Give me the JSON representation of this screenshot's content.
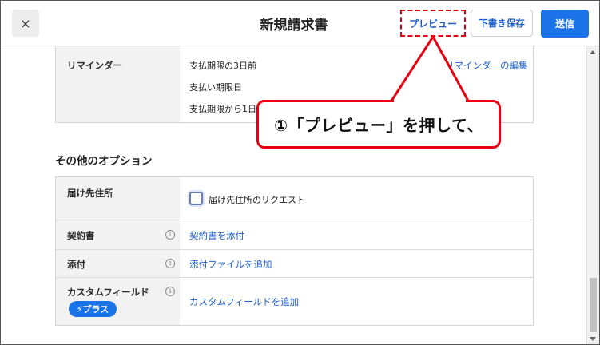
{
  "header": {
    "close_icon": "×",
    "title": "新規請求書",
    "preview_label": "プレビュー",
    "draft_label": "下書き保存",
    "send_label": "送信"
  },
  "reminder": {
    "label": "リマインダー",
    "items": [
      "支払期限の3日前",
      "支払い期限日",
      "支払期限から1日"
    ],
    "edit_link": "リマインダーの編集"
  },
  "other_options": {
    "title": "その他のオプション",
    "rows": [
      {
        "label": "届け先住所",
        "value": "届け先住所のリクエスト"
      },
      {
        "label": "契約書",
        "value": "契約書を添付"
      },
      {
        "label": "添付",
        "value": "添付ファイルを追加"
      },
      {
        "label": "カスタムフィールド",
        "value": "カスタムフィールドを追加",
        "badge": "⚡プラス"
      }
    ]
  },
  "annotation": {
    "text": "①「プレビュー」を押して、"
  },
  "colors": {
    "accent": "#1a73e8",
    "highlight": "#e60012"
  }
}
